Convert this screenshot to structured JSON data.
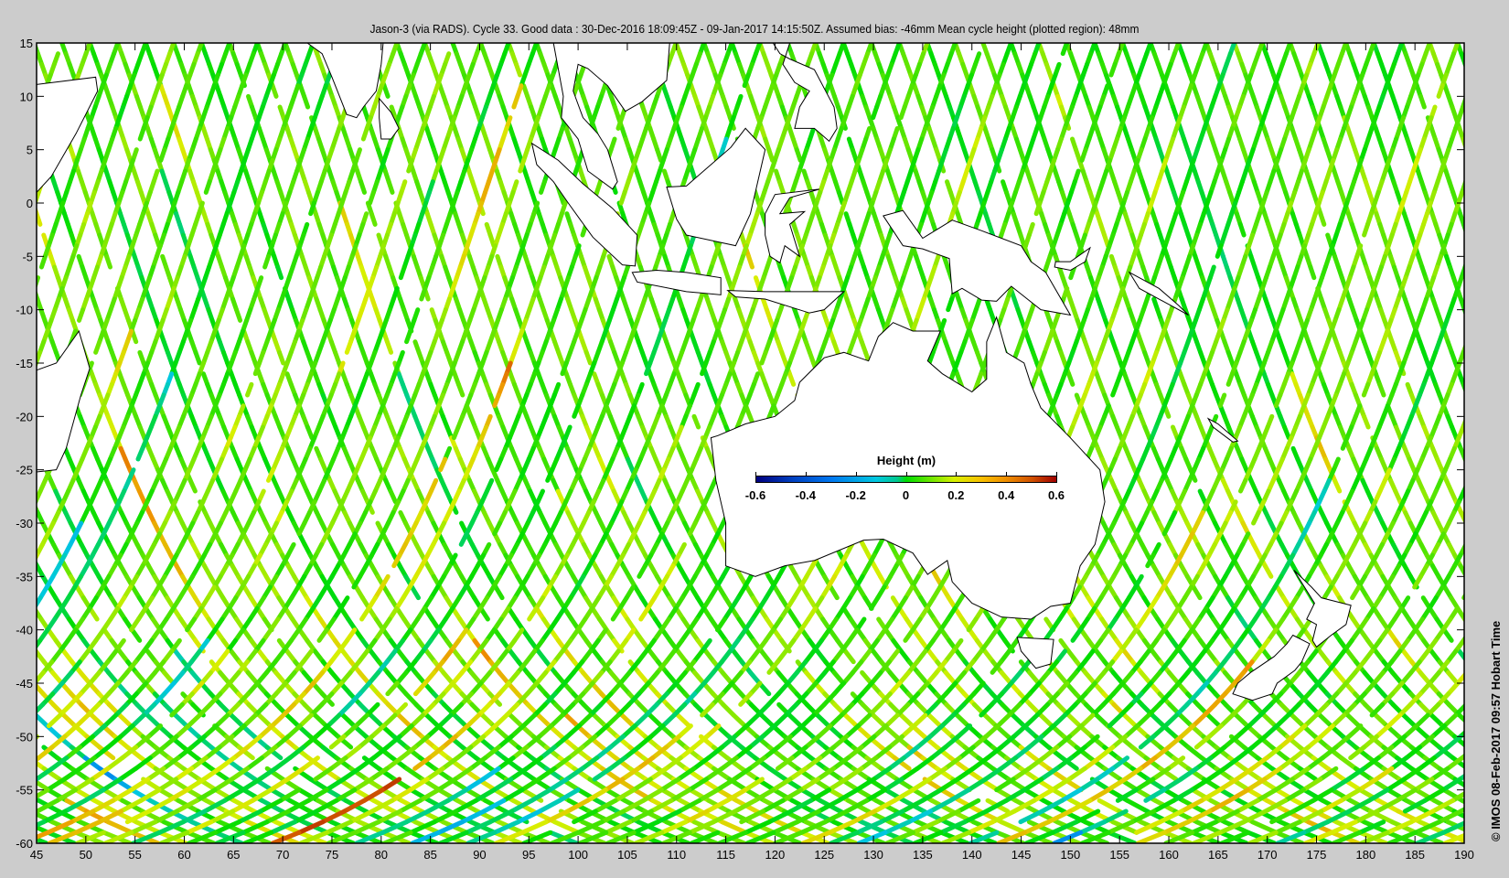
{
  "title": "Jason-3 (via RADS). Cycle 33. Good data : 30-Dec-2016 18:09:45Z - 09-Jan-2017 14:15:50Z. Assumed bias: -46mm  Mean cycle height (plotted region): 48mm",
  "credit": "© IMOS 08-Feb-2017 09:57 Hobart Time",
  "axes": {
    "lon_range": [
      45,
      190
    ],
    "lat_range": [
      -60,
      15
    ],
    "lon_ticks": [
      "45",
      "50",
      "55",
      "60",
      "65",
      "70",
      "75",
      "80",
      "85",
      "90",
      "95",
      "100",
      "105",
      "110",
      "115",
      "120",
      "125",
      "130",
      "135",
      "140",
      "145",
      "150",
      "155",
      "160",
      "165",
      "170",
      "175",
      "180",
      "185",
      "190"
    ],
    "lat_ticks": [
      "15",
      "10",
      "5",
      "0",
      "-5",
      "-10",
      "-15",
      "-20",
      "-25",
      "-30",
      "-35",
      "-40",
      "-45",
      "-50",
      "-55",
      "-60"
    ]
  },
  "colorbar": {
    "title": "Height (m)",
    "range": [
      -0.6,
      0.6
    ],
    "labels": [
      "-0.6",
      "-0.4",
      "-0.2",
      "0",
      "0.2",
      "0.4",
      "0.6"
    ],
    "colors": [
      "#00007f",
      "#0078f0",
      "#00c8e0",
      "#00dd00",
      "#d8f000",
      "#f09000",
      "#a00000"
    ]
  }
}
